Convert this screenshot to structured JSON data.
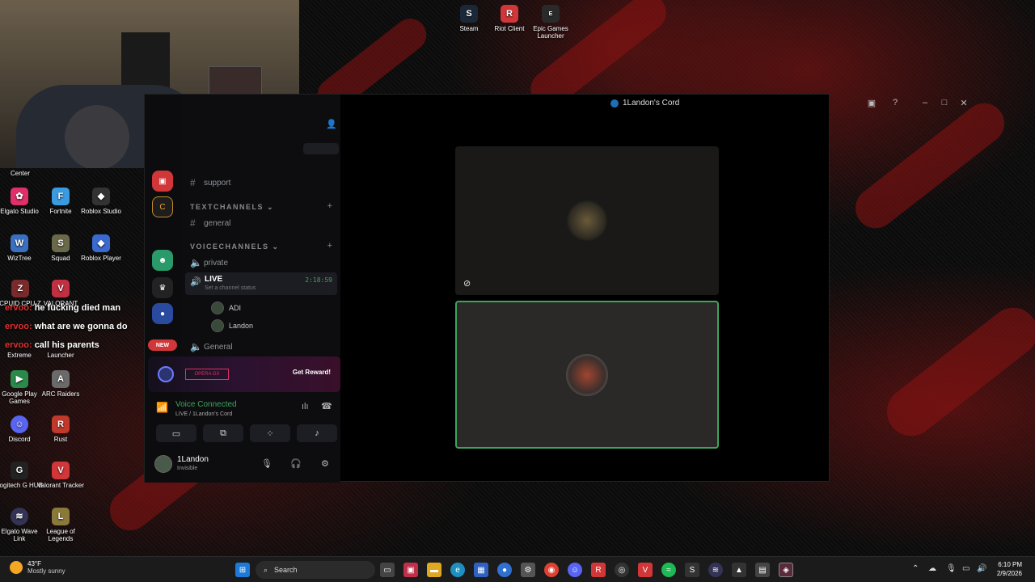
{
  "desktop": {
    "top_icons": [
      {
        "label": "Steam",
        "icon": "steam-icon",
        "color": "#1b2838"
      },
      {
        "label": "Riot Client",
        "icon": "riot-icon",
        "color": "#d13639"
      },
      {
        "label": "Epic Games Launcher",
        "icon": "epic-icon",
        "color": "#2a2a2a"
      }
    ],
    "left_icons": [
      {
        "label": "Center",
        "icon": "app-icon",
        "color": "#444444"
      },
      {
        "label": "Elgato Studio",
        "icon": "elgato-studio-icon",
        "color": "#e0306a"
      },
      {
        "label": "Fortnite",
        "icon": "fortnite-icon",
        "color": "#3a9be0"
      },
      {
        "label": "Roblox Studio",
        "icon": "roblox-studio-icon",
        "color": "#333333"
      },
      {
        "label": "WizTree",
        "icon": "wiztree-icon",
        "color": "#3a70c0"
      },
      {
        "label": "Squad",
        "icon": "squad-icon",
        "color": "#6a6a4a"
      },
      {
        "label": "Roblox Player",
        "icon": "roblox-player-icon",
        "color": "#3a6ad0"
      },
      {
        "label": "CPUID CPU-Z",
        "icon": "cpuz-icon",
        "color": "#7a2a2a"
      },
      {
        "label": "VALORANT",
        "icon": "valorant-icon",
        "color": "#c03040"
      },
      {
        "label": "Extreme",
        "icon": "app-icon",
        "color": "#444444"
      },
      {
        "label": "Launcher",
        "icon": "launcher-icon",
        "color": "#555555"
      },
      {
        "label": "Google Play Games",
        "icon": "google-play-icon",
        "color": "#2a8a4a"
      },
      {
        "label": "ARC Raiders",
        "icon": "arc-raiders-icon",
        "color": "#6a6a6a"
      },
      {
        "label": "Discord",
        "icon": "discord-icon",
        "color": "#5865f2"
      },
      {
        "label": "Rust",
        "icon": "rust-icon",
        "color": "#c0392b"
      },
      {
        "label": "Logitech G HUB",
        "icon": "logitech-icon",
        "color": "#222222"
      },
      {
        "label": "Valorant Tracker",
        "icon": "valorant-tracker-icon",
        "color": "#d13639"
      },
      {
        "label": "Elgato Wave Link",
        "icon": "wave-link-icon",
        "color": "#333355"
      },
      {
        "label": "League of Legends",
        "icon": "league-icon",
        "color": "#8a7a3a"
      }
    ]
  },
  "chat_overlay": [
    {
      "user": "ervoo:",
      "message": "he fucking died man"
    },
    {
      "user": "ervoo:",
      "message": "what are we gonna do"
    },
    {
      "user": "ervoo:",
      "message": "call his parents"
    }
  ],
  "discord": {
    "window_title": "1Landon's Cord",
    "guild_badge": "NEW",
    "channels": {
      "support": "support",
      "text_category": "TEXTCHANNELS",
      "general_text": "general",
      "voice_category": "VOICECHANNELS",
      "private": "private",
      "live_name": "LIVE",
      "live_status": "Set a channel status",
      "live_timer": "2:18:59",
      "member_1": "ADI",
      "member_2": "Landon",
      "general_voice": "General"
    },
    "promo": {
      "badge": "OPERA GX",
      "cta": "Get Reward!"
    },
    "voice": {
      "status": "Voice Connected",
      "location": "LIVE / 1Landon's Cord"
    },
    "user": {
      "name": "1Landon",
      "status": "Invisible"
    },
    "accent": "#3ba55d"
  },
  "taskbar": {
    "weather_temp": "43°F",
    "weather_desc": "Mostly sunny",
    "search_placeholder": "Search",
    "time": "6:10 PM",
    "date": "2/9/2026"
  }
}
